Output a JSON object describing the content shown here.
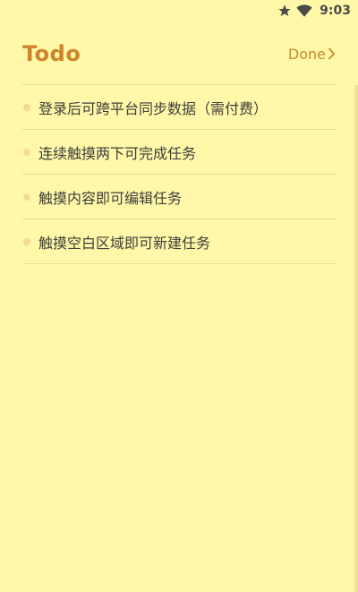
{
  "status_bar": {
    "time": "9:03",
    "icons": [
      "star-icon",
      "wifi-icon"
    ]
  },
  "header": {
    "title": "Todo",
    "done_label": "Done",
    "done_icon": "chevron-right-icon"
  },
  "todos": [
    {
      "text": "登录后可跨平台同步数据（需付费）"
    },
    {
      "text": "连续触摸两下可完成任务"
    },
    {
      "text": "触摸内容即可编辑任务"
    },
    {
      "text": "触摸空白区域即可新建任务"
    }
  ],
  "colors": {
    "background": "#fff8a8",
    "title": "#d0832a",
    "done": "#c58b2d",
    "bullet": "#f4d99a",
    "divider": "#e8dc93",
    "text": "#3d3d3d"
  }
}
